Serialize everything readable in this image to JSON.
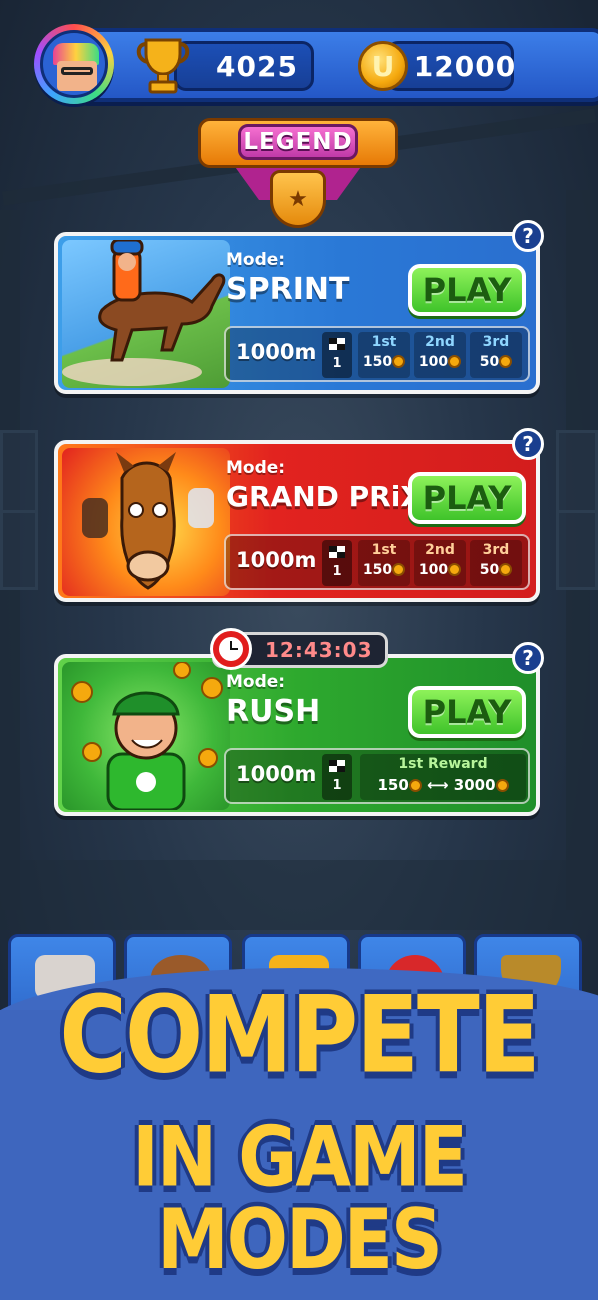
{
  "header": {
    "trophies": "4025",
    "coins": "12000",
    "coin_symbol": "U"
  },
  "league": {
    "label": "LEGEND"
  },
  "modes": [
    {
      "mode_label": "Mode:",
      "name": "SPRINT",
      "play_label": "PLAY",
      "help_label": "?",
      "distance": "1000m",
      "laps": "1",
      "prizes": [
        {
          "place": "1st",
          "amount": "150"
        },
        {
          "place": "2nd",
          "amount": "100"
        },
        {
          "place": "3rd",
          "amount": "50"
        }
      ]
    },
    {
      "mode_label": "Mode:",
      "name": "GRAND PRiX",
      "play_label": "PLAY",
      "help_label": "?",
      "distance": "1000m",
      "laps": "1",
      "prizes": [
        {
          "place": "1st",
          "amount": "150"
        },
        {
          "place": "2nd",
          "amount": "100"
        },
        {
          "place": "3rd",
          "amount": "50"
        }
      ]
    },
    {
      "mode_label": "Mode:",
      "name": "RUSH",
      "play_label": "PLAY",
      "help_label": "?",
      "distance": "1000m",
      "laps": "1",
      "reward_title": "1st Reward",
      "reward_min": "150",
      "reward_max": "3000",
      "timer": "12:43:03"
    }
  ],
  "promo": {
    "line1": "COMPETE",
    "line2": "IN GAME MODES"
  },
  "colors": {
    "sprint": "#2a78d6",
    "grand_prix": "#e2231f",
    "rush": "#2ea92e",
    "play_button": "#3fc32a",
    "promo_text": "#ffcc36"
  }
}
